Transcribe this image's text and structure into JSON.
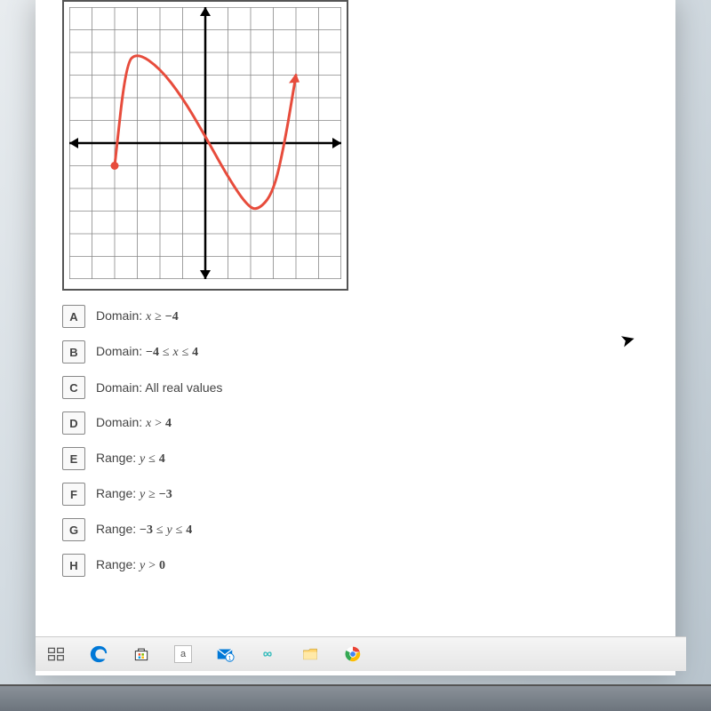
{
  "chart_data": {
    "type": "line",
    "title": "",
    "xlabel": "",
    "ylabel": "",
    "xlim": [
      -6,
      6
    ],
    "ylim": [
      -6,
      6
    ],
    "grid": true,
    "series": [
      {
        "name": "curve",
        "color": "#e74c3c",
        "endpoints": {
          "left": {
            "x": -4,
            "y": -1,
            "style": "closed"
          },
          "right": {
            "x": 4,
            "y": 3,
            "style": "arrow"
          }
        },
        "points": [
          {
            "x": -4,
            "y": -1
          },
          {
            "x": -3.5,
            "y": 3.5
          },
          {
            "x": -3,
            "y": 4
          },
          {
            "x": -2,
            "y": 3.3
          },
          {
            "x": -1,
            "y": 2
          },
          {
            "x": 0,
            "y": 0.3
          },
          {
            "x": 1,
            "y": -1.5
          },
          {
            "x": 1.8,
            "y": -2.7
          },
          {
            "x": 2.3,
            "y": -3
          },
          {
            "x": 3,
            "y": -2.2
          },
          {
            "x": 3.5,
            "y": 0
          },
          {
            "x": 4,
            "y": 3
          }
        ]
      }
    ]
  },
  "options": [
    {
      "letter": "A",
      "label": "Domain:",
      "expr_html": "<span class='math'>x</span> <span class='op'>≥</span> <span class='num'>−4</span>"
    },
    {
      "letter": "B",
      "label": "Domain:",
      "expr_html": "<span class='num'>−4</span> <span class='op'>≤</span> <span class='math'>x</span> <span class='op'>≤</span> <span class='num'>4</span>"
    },
    {
      "letter": "C",
      "label": "Domain:",
      "expr_html": "All real values"
    },
    {
      "letter": "D",
      "label": "Domain:",
      "expr_html": "<span class='math'>x</span> <span class='op'>&gt;</span> <span class='num'>4</span>"
    },
    {
      "letter": "E",
      "label": "Range:",
      "expr_html": "<span class='math'>y</span> <span class='op'>≤</span> <span class='num'>4</span>"
    },
    {
      "letter": "F",
      "label": "Range:",
      "expr_html": "<span class='math'>y</span> <span class='op'>≥</span> <span class='num'>−3</span>"
    },
    {
      "letter": "G",
      "label": "Range:",
      "expr_html": "<span class='num'>−3</span> <span class='op'>≤</span> <span class='math'>y</span> <span class='op'>≤</span> <span class='num'>4</span>"
    },
    {
      "letter": "H",
      "label": "Range:",
      "expr_html": "<span class='math'>y</span> <span class='op'>&gt;</span> <span class='num'>0</span>"
    }
  ],
  "taskbar": {
    "items": [
      "task-view",
      "edge",
      "store",
      "a",
      "mail",
      "infinity",
      "explorer",
      "chrome"
    ]
  }
}
